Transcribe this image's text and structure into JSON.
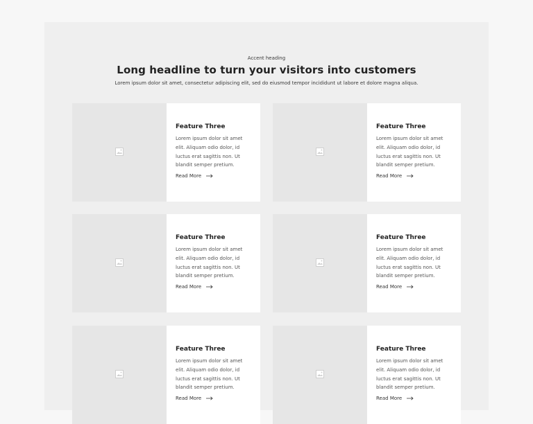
{
  "header": {
    "accent": "Accent heading",
    "headline": "Long headline to turn your visitors into customers",
    "subheading": "Lorem ipsum dolor sit amet, consectetur adipiscing elit, sed do eiusmod tempor incididunt ut labore et dolore magna aliqua."
  },
  "cards": [
    {
      "title": "Feature Three",
      "body_lines": [
        "Lorem ipsum dolor sit amet",
        "elit. Aliquam odio dolor, id",
        "luctus erat sagittis non. Ut",
        "blandit semper pretium."
      ],
      "link": "Read More"
    },
    {
      "title": "Feature Three",
      "body_lines": [
        "Lorem ipsum dolor sit amet",
        "elit. Aliquam odio dolor, id",
        "luctus erat sagittis non. Ut",
        "blandit semper pretium."
      ],
      "link": "Read More"
    },
    {
      "title": "Feature Three",
      "body_lines": [
        "Lorem ipsum dolor sit amet",
        "elit. Aliquam odio dolor, id",
        "luctus erat sagittis non. Ut",
        "blandit semper pretium."
      ],
      "link": "Read More"
    },
    {
      "title": "Feature Three",
      "body_lines": [
        "Lorem ipsum dolor sit amet",
        "elit. Aliquam odio dolor, id",
        "luctus erat sagittis non. Ut",
        "blandit semper pretium."
      ],
      "link": "Read More"
    },
    {
      "title": "Feature Three",
      "body_lines": [
        "Lorem ipsum dolor sit amet",
        "elit. Aliquam odio dolor, id",
        "luctus erat sagittis non. Ut",
        "blandit semper pretium."
      ],
      "link": "Read More"
    },
    {
      "title": "Feature Three",
      "body_lines": [
        "Lorem ipsum dolor sit amet",
        "elit. Aliquam odio dolor, id",
        "luctus erat sagittis non. Ut",
        "blandit semper pretium."
      ],
      "link": "Read More"
    }
  ],
  "icons": {
    "placeholder": "image-placeholder-icon",
    "arrow": "arrow-right-icon"
  },
  "colors": {
    "background": "#f7f7f7",
    "section": "#efefef",
    "card": "#ffffff",
    "image_placeholder": "#e6e6e6",
    "heading": "#222222",
    "text": "#555555"
  }
}
